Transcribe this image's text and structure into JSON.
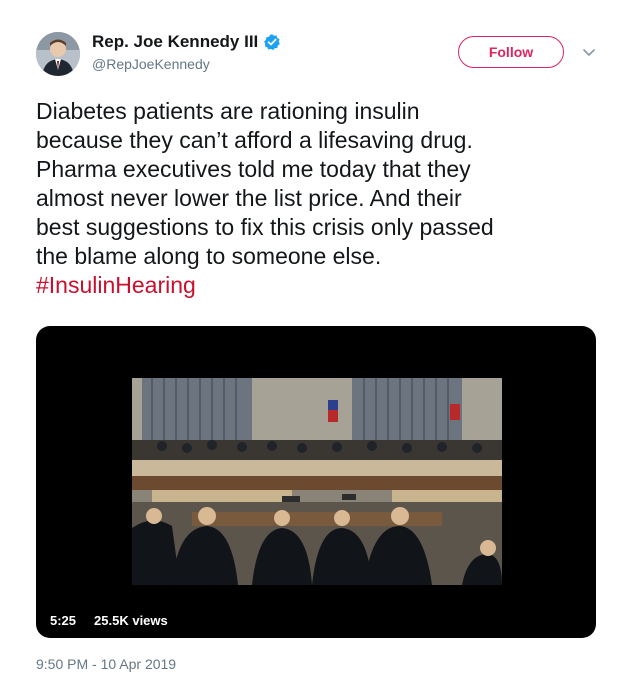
{
  "author": {
    "display_name": "Rep. Joe Kennedy III",
    "handle": "@RepJoeKennedy",
    "verified": true
  },
  "follow_button": {
    "label": "Follow"
  },
  "icons": {
    "verified": "verified-badge-icon",
    "caret": "chevron-down-icon"
  },
  "tweet": {
    "text": "Diabetes patients are rationing insulin\nbecause they can’t afford a lifesaving drug.\nPharma executives told me today that they\nalmost never lower the list price. And their\nbest suggestions to fix this crisis only passed\nthe blame along to someone else.",
    "hashtag": "#InsulinHearing"
  },
  "media": {
    "duration": "5:25",
    "views": "25.5K views"
  },
  "timestamp": "9:50 PM - 10 Apr 2019",
  "colors": {
    "follow_accent": "#e0245e",
    "hashtag": "#c8102e",
    "verified": "#1da1f2",
    "muted_text": "#657786"
  }
}
